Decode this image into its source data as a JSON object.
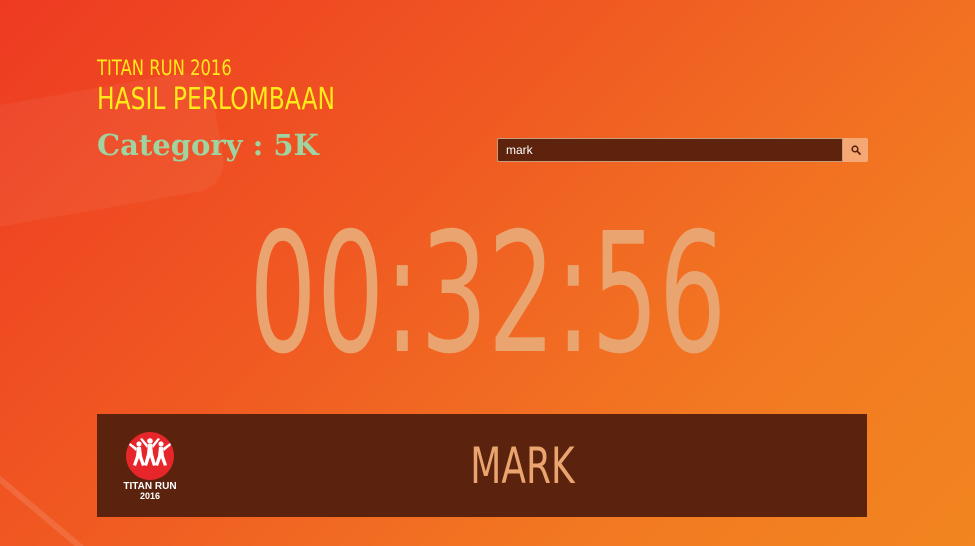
{
  "header": {
    "event_name": "TITAN RUN 2016",
    "results_title": "HASIL PERLOMBAAN",
    "category_label": "Category : 5K"
  },
  "search": {
    "value": "mark",
    "placeholder": "",
    "button_icon": "search-icon"
  },
  "result": {
    "time": "00:32:56",
    "runner_name": "MARK"
  },
  "logo": {
    "text_line1": "TITAN RUN",
    "text_line2": "2016",
    "icon": "runners-logo"
  },
  "colors": {
    "background_start": "#ee3a22",
    "background_end": "#f2851f",
    "title_yellow": "#ffeb1a",
    "category_green": "#9fd3a0",
    "dark_brown": "#5b230d",
    "timer_tan": "#e9a46f",
    "logo_red": "#e6262b"
  }
}
